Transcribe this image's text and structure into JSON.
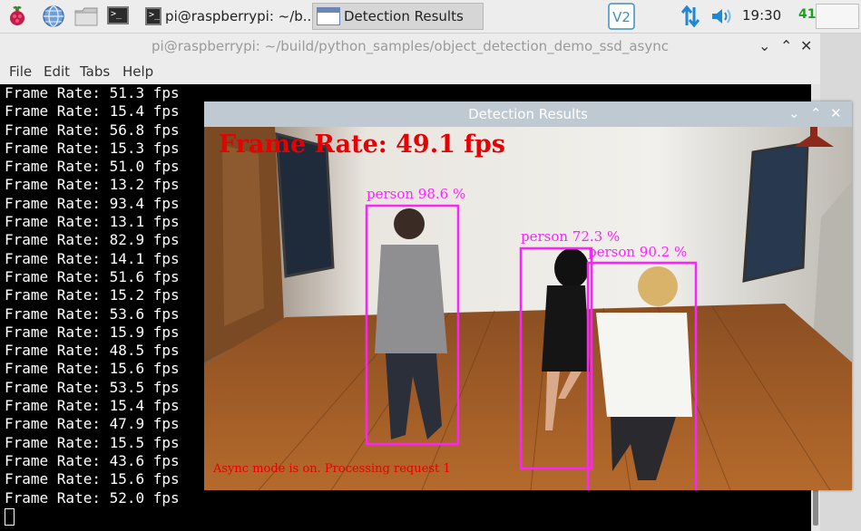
{
  "taskbar": {
    "tasks": [
      {
        "label": "pi@raspberrypi: ~/b..."
      },
      {
        "label": "Detection Results"
      }
    ],
    "clock": "19:30",
    "cpu": "41",
    "icons": [
      "raspberry-menu-icon",
      "browser-globe-icon",
      "file-manager-icon",
      "terminal-icon",
      "vnc-icon",
      "network-arrows-icon",
      "volume-icon"
    ]
  },
  "terminal": {
    "title": "pi@raspberrypi: ~/build/python_samples/object_detection_demo_ssd_async",
    "menu": [
      "File",
      "Edit",
      "Tabs",
      "Help"
    ],
    "lines": [
      "Frame Rate: 51.3 fps",
      "Frame Rate: 15.4 fps",
      "Frame Rate: 56.8 fps",
      "Frame Rate: 15.3 fps",
      "Frame Rate: 51.0 fps",
      "Frame Rate: 13.2 fps",
      "Frame Rate: 93.4 fps",
      "Frame Rate: 13.1 fps",
      "Frame Rate: 82.9 fps",
      "Frame Rate: 14.1 fps",
      "Frame Rate: 51.6 fps",
      "Frame Rate: 15.2 fps",
      "Frame Rate: 53.6 fps",
      "Frame Rate: 15.9 fps",
      "Frame Rate: 48.5 fps",
      "Frame Rate: 15.6 fps",
      "Frame Rate: 53.5 fps",
      "Frame Rate: 15.4 fps",
      "Frame Rate: 47.9 fps",
      "Frame Rate: 15.5 fps",
      "Frame Rate: 43.6 fps",
      "Frame Rate: 15.6 fps",
      "Frame Rate: 52.0 fps"
    ]
  },
  "detection": {
    "title": "Detection Results",
    "frame_rate": "Frame Rate: 49.1 fps",
    "async_status": "Async mode is on. Processing request 1",
    "boxes": [
      {
        "label": "person 98.6 %"
      },
      {
        "label": "person 72.3 %"
      },
      {
        "label": "person 90.2 %"
      }
    ],
    "colors": {
      "box": "#ff22ff",
      "fps_text": "#e80000"
    }
  }
}
